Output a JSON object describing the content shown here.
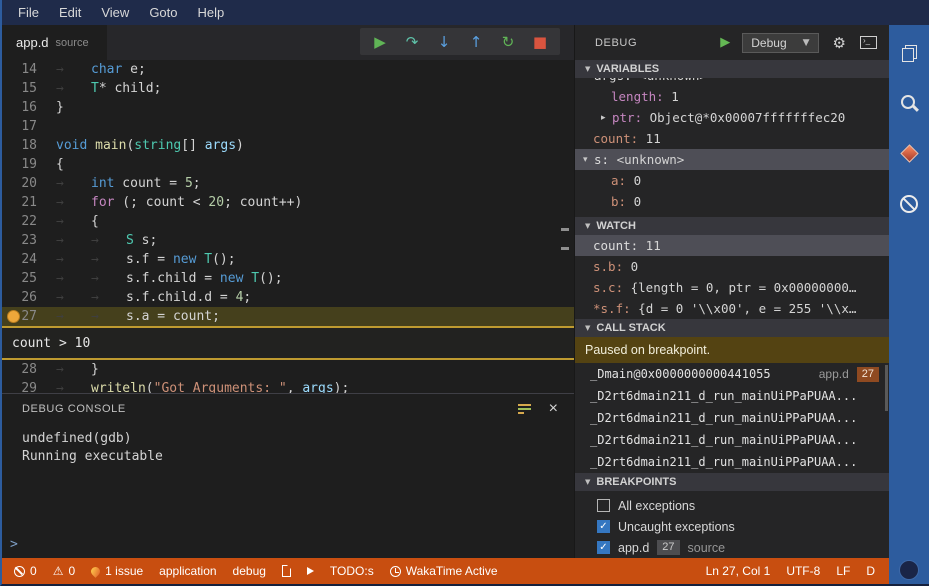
{
  "colors": {
    "menubar_bg": "#1f2b4a",
    "activitybar_bg": "#2d5c9e",
    "statusbar_bg": "#c84e10",
    "editor_bg": "#1e1e1e",
    "sidebar_bg": "#252526",
    "current_line_bg": "#45401c",
    "breakpoint": "#eda73a",
    "condition_border": "#bf9b30",
    "paused_bg": "#544312",
    "selection_bg": "#4e4e56",
    "keyword": "#569cd6",
    "control": "#c586c0",
    "type": "#4ec9b0",
    "string": "#ce9178",
    "number": "#b5cea8"
  },
  "menubar": {
    "items": [
      "File",
      "Edit",
      "View",
      "Goto",
      "Help"
    ]
  },
  "tab": {
    "name": "app.d",
    "hint": "source"
  },
  "toolbar": {
    "icons": [
      {
        "name": "continue-icon",
        "glyph": "▶",
        "color": "#60b456"
      },
      {
        "name": "step-over-icon",
        "glyph": "↷",
        "color": "#5ec1a8"
      },
      {
        "name": "step-into-icon",
        "glyph": "↓",
        "color": "#5aa0e0"
      },
      {
        "name": "step-out-icon",
        "glyph": "↑",
        "color": "#5aa0e0"
      },
      {
        "name": "restart-icon",
        "glyph": "↻",
        "color": "#60b456"
      },
      {
        "name": "stop-icon",
        "glyph": "■",
        "color": "#d9543f"
      }
    ]
  },
  "code": {
    "condition_widget": {
      "after": "27",
      "text": "count > 10"
    },
    "lines": [
      {
        "num": "14",
        "indent": 1,
        "tokens": [
          {
            "c": "kw",
            "t": "char"
          },
          {
            "c": "pl",
            "t": " e;"
          }
        ]
      },
      {
        "num": "15",
        "indent": 1,
        "tokens": [
          {
            "c": "ty",
            "t": "T"
          },
          {
            "c": "pl",
            "t": "* child;"
          }
        ]
      },
      {
        "num": "16",
        "indent": 0,
        "tokens": [
          {
            "c": "pl",
            "t": "}"
          }
        ]
      },
      {
        "num": "17",
        "indent": 0,
        "tokens": []
      },
      {
        "num": "18",
        "indent": 0,
        "tokens": [
          {
            "c": "kw",
            "t": "void"
          },
          {
            "c": "pl",
            "t": " "
          },
          {
            "c": "fn",
            "t": "main"
          },
          {
            "c": "pl",
            "t": "("
          },
          {
            "c": "ty",
            "t": "string"
          },
          {
            "c": "pl",
            "t": "[] "
          },
          {
            "c": "vr",
            "t": "args"
          },
          {
            "c": "pl",
            "t": ")"
          }
        ]
      },
      {
        "num": "19",
        "indent": 0,
        "tokens": [
          {
            "c": "pl",
            "t": "{"
          }
        ]
      },
      {
        "num": "20",
        "indent": 1,
        "tokens": [
          {
            "c": "kw",
            "t": "int"
          },
          {
            "c": "pl",
            "t": " count = "
          },
          {
            "c": "num",
            "t": "5"
          },
          {
            "c": "pl",
            "t": ";"
          }
        ]
      },
      {
        "num": "21",
        "indent": 1,
        "tokens": [
          {
            "c": "ct",
            "t": "for"
          },
          {
            "c": "pl",
            "t": " (; count < "
          },
          {
            "c": "num",
            "t": "20"
          },
          {
            "c": "pl",
            "t": "; count++)"
          }
        ]
      },
      {
        "num": "22",
        "indent": 1,
        "tokens": [
          {
            "c": "pl",
            "t": "{"
          }
        ]
      },
      {
        "num": "23",
        "indent": 2,
        "tokens": [
          {
            "c": "ty",
            "t": "S"
          },
          {
            "c": "pl",
            "t": " s;"
          }
        ]
      },
      {
        "num": "24",
        "indent": 2,
        "tokens": [
          {
            "c": "pl",
            "t": "s.f = "
          },
          {
            "c": "kw",
            "t": "new"
          },
          {
            "c": "pl",
            "t": " "
          },
          {
            "c": "ty",
            "t": "T"
          },
          {
            "c": "pl",
            "t": "();"
          }
        ]
      },
      {
        "num": "25",
        "indent": 2,
        "tokens": [
          {
            "c": "pl",
            "t": "s.f.child = "
          },
          {
            "c": "kw",
            "t": "new"
          },
          {
            "c": "pl",
            "t": " "
          },
          {
            "c": "ty",
            "t": "T"
          },
          {
            "c": "pl",
            "t": "();"
          }
        ]
      },
      {
        "num": "26",
        "indent": 2,
        "tokens": [
          {
            "c": "pl",
            "t": "s.f.child.d = "
          },
          {
            "c": "num",
            "t": "4"
          },
          {
            "c": "pl",
            "t": ";"
          }
        ]
      },
      {
        "num": "27",
        "indent": 2,
        "current": true,
        "breakpoint": true,
        "tokens": [
          {
            "c": "pl",
            "t": "s.a = count;"
          }
        ]
      },
      {
        "num": "28",
        "indent": 1,
        "tokens": [
          {
            "c": "pl",
            "t": "}"
          }
        ]
      },
      {
        "num": "29",
        "indent": 1,
        "tokens": [
          {
            "c": "fn",
            "t": "writeln"
          },
          {
            "c": "pl",
            "t": "("
          },
          {
            "c": "str",
            "t": "\"Got Arguments: \""
          },
          {
            "c": "pl",
            "t": ", "
          },
          {
            "c": "vr",
            "t": "args"
          },
          {
            "c": "pl",
            "t": ");"
          }
        ]
      }
    ]
  },
  "console": {
    "title": "DEBUG CONSOLE",
    "lines": [
      "undefined(gdb)",
      "Running executable"
    ],
    "prompt": ">"
  },
  "debug_header": {
    "title": "DEBUG",
    "config": "Debug"
  },
  "variables": {
    "title": "VARIABLES",
    "rows": [
      {
        "name": "args",
        "value": "<unknown>",
        "arrow": "expanded",
        "indent": 0,
        "ncls": "white",
        "clipped": true
      },
      {
        "name": "length",
        "value": "1",
        "indent": 1,
        "ncls": "purple"
      },
      {
        "name": "ptr",
        "value": "Object@*0x00007fffffffec20",
        "arrow": "collapsed",
        "indent": 1,
        "ncls": "purple"
      },
      {
        "name": "count",
        "value": "11",
        "indent": 0,
        "ncls": "orange"
      },
      {
        "name": "s",
        "value": "<unknown>",
        "arrow": "expanded",
        "indent": 0,
        "ncls": "white",
        "selected": true
      },
      {
        "name": "a",
        "value": "0",
        "indent": 1,
        "ncls": "orange"
      },
      {
        "name": "b",
        "value": "0",
        "indent": 1,
        "ncls": "orange"
      }
    ]
  },
  "watch": {
    "title": "WATCH",
    "rows": [
      {
        "name": "count",
        "value": "11",
        "indent": 0,
        "ncls": "white",
        "selected": true
      },
      {
        "name": "s.b",
        "value": "0",
        "indent": 0,
        "ncls": "orange"
      },
      {
        "name": "s.c",
        "value": "{length = 0, ptr = 0x00000000…",
        "indent": 0,
        "ncls": "orange"
      },
      {
        "name": "*s.f",
        "value": "{d = 0 '\\\\x00', e = 255 '\\\\x…",
        "indent": 0,
        "ncls": "orange"
      }
    ]
  },
  "callstack": {
    "title": "CALL STACK",
    "status": "Paused on breakpoint.",
    "frames": [
      {
        "fn": "_Dmain@0x0000000000441055",
        "file": "app.d",
        "line": "27"
      },
      {
        "fn": "_D2rt6dmain211_d_run_mainUiPPaPUAA..."
      },
      {
        "fn": "_D2rt6dmain211_d_run_mainUiPPaPUAA..."
      },
      {
        "fn": "_D2rt6dmain211_d_run_mainUiPPaPUAA..."
      },
      {
        "fn": "_D2rt6dmain211_d_run_mainUiPPaPUAA..."
      }
    ]
  },
  "breakpoints": {
    "title": "BREAKPOINTS",
    "items": [
      {
        "checked": false,
        "label": "All exceptions"
      },
      {
        "checked": true,
        "label": "Uncaught exceptions"
      },
      {
        "checked": true,
        "label": "app.d",
        "line": "27",
        "hint": "source"
      }
    ]
  },
  "activitybar": {
    "icons": [
      "files-icon",
      "search-icon",
      "gem-icon",
      "blocked-icon"
    ]
  },
  "statusbar": {
    "left": [
      {
        "icon": "error-icon",
        "text": "0"
      },
      {
        "icon": "warning-icon",
        "text": "0"
      },
      {
        "icon": "flame-icon",
        "text": "1 issue"
      },
      {
        "text": "application"
      },
      {
        "text": "debug"
      },
      {
        "icon": "file-icon"
      },
      {
        "icon": "play-icon"
      },
      {
        "text": "TODO:s"
      },
      {
        "icon": "clock-icon",
        "text": "WakaTime Active"
      }
    ],
    "right": [
      {
        "text": "Ln 27, Col 1"
      },
      {
        "text": "UTF-8"
      },
      {
        "text": "LF"
      },
      {
        "text": "D"
      }
    ]
  }
}
